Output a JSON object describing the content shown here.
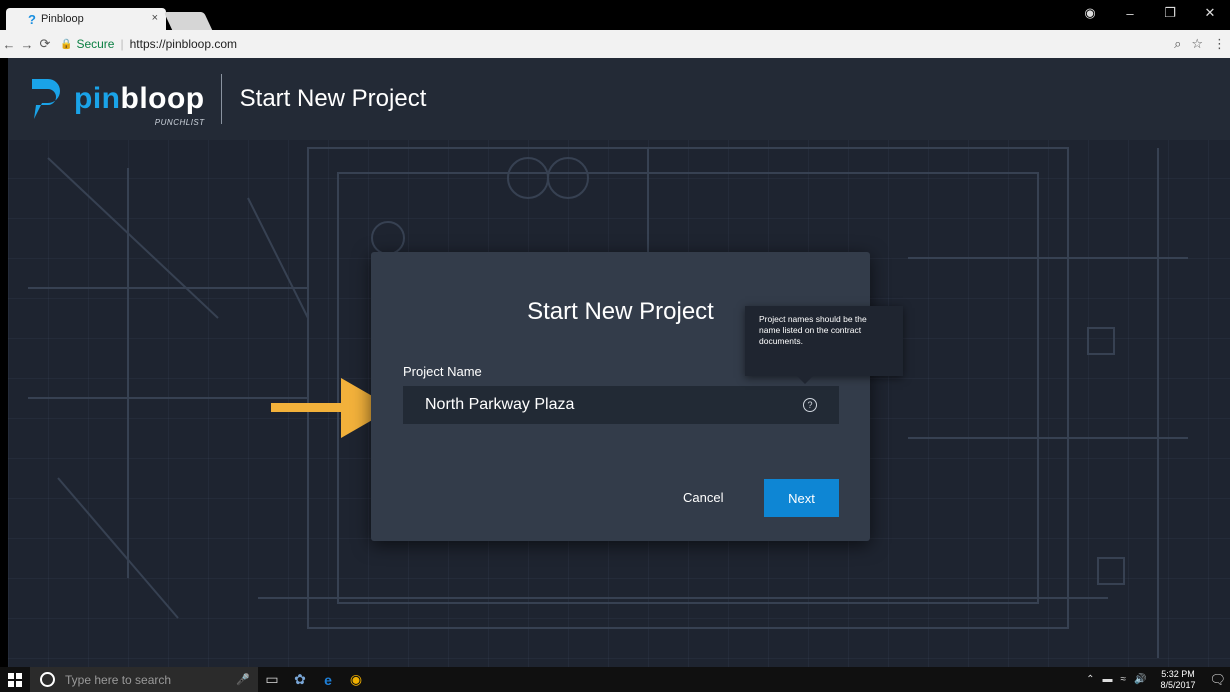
{
  "browser": {
    "tab_title": "Pinbloop",
    "tab_close": "×",
    "secure_label": "Secure",
    "url": "https://pinbloop.com"
  },
  "header": {
    "logo_pin": "pin",
    "logo_bloop": "bloop",
    "logo_sub": "PUNCHLIST",
    "title": "Start New Project"
  },
  "modal": {
    "title": "Start New Project",
    "field_label": "Project Name",
    "field_value": "North Parkway Plaza",
    "help_symbol": "?",
    "tooltip": "Project names should be the name listed on the contract documents.",
    "cancel": "Cancel",
    "next": "Next"
  },
  "taskbar": {
    "search_placeholder": "Type here to search",
    "time": "5:32 PM",
    "date": "8/5/2017"
  },
  "colors": {
    "brand_blue": "#1aa3e8",
    "button_blue": "#0e86d4",
    "arrow": "#f2b13b",
    "modal_bg": "#333c4a",
    "app_bg": "#1e2430"
  }
}
